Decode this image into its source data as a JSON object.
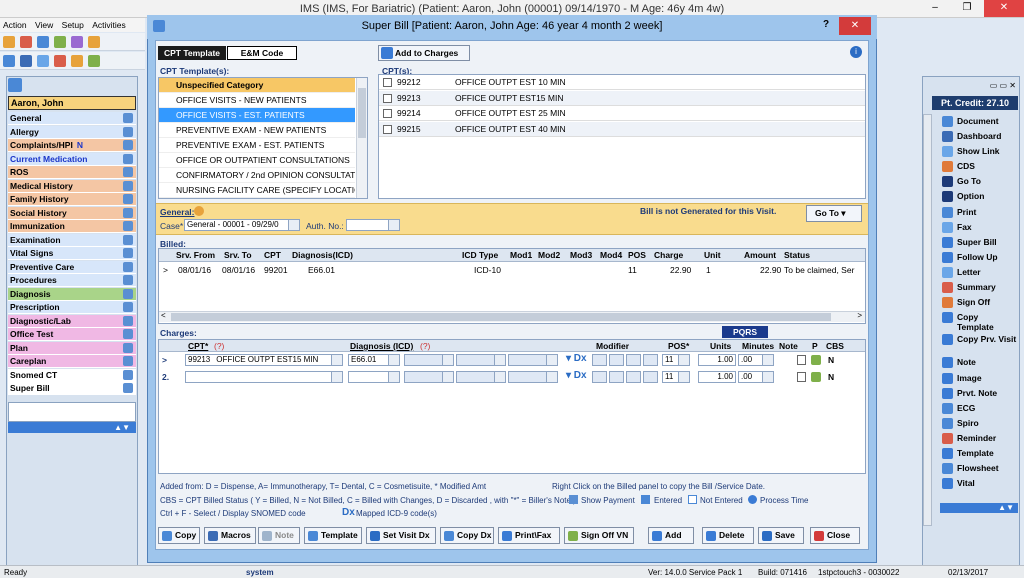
{
  "app": {
    "title": "IMS (IMS, For Bariatric)    (Patient: Aaron, John  (00001) 09/14/1970 - M Age: 46y 4m 4w)"
  },
  "menu": [
    "Action",
    "View",
    "Setup",
    "Activities"
  ],
  "left": {
    "patient": "Aaron, John",
    "items": [
      {
        "label": "General",
        "color": "#d7e6fa"
      },
      {
        "label": "Allergy",
        "color": "#d7e6fa"
      },
      {
        "label": "Complaints/HPI",
        "color": "#f4c6a4",
        "extra": "N"
      },
      {
        "label": "Current Medication",
        "color": "#d7e6fa",
        "blue": true
      },
      {
        "label": "ROS",
        "color": "#f4c6a4"
      },
      {
        "label": "Medical History",
        "color": "#f4c6a4"
      },
      {
        "label": "Family History",
        "color": "#f4c6a4"
      },
      {
        "label": "Social History",
        "color": "#f4c6a4"
      },
      {
        "label": "Immunization",
        "color": "#f4c6a4"
      },
      {
        "label": "Examination",
        "color": "#d7e6fa"
      },
      {
        "label": "Vital Signs",
        "color": "#d7e6fa"
      },
      {
        "label": "Preventive Care",
        "color": "#d7e6fa"
      },
      {
        "label": "Procedures",
        "color": "#d7e6fa"
      },
      {
        "label": "Diagnosis",
        "color": "#a9d489"
      },
      {
        "label": "Prescription",
        "color": "#d7e6fa"
      },
      {
        "label": "Diagnostic/Lab",
        "color": "#f0b8e4"
      },
      {
        "label": "Office Test",
        "color": "#f0b8e4"
      },
      {
        "label": "Plan",
        "color": "#f0b8e4"
      },
      {
        "label": "Careplan",
        "color": "#f0b8e4"
      },
      {
        "label": "Snomed CT",
        "color": "#ffffff"
      },
      {
        "label": "Super Bill",
        "color": "#ffffff"
      }
    ]
  },
  "right": {
    "credit": "Pt. Credit: 27.10",
    "buttons": [
      "Document",
      "Dashboard",
      "Show Link",
      "CDS",
      "Go To",
      "Option",
      "Print",
      "Fax",
      "Super Bill",
      "Follow Up",
      "Letter",
      "Summary",
      "Sign Off",
      "Copy Template",
      "Copy Prv. Visit",
      "Note",
      "Image",
      "Prvt. Note",
      "ECG",
      "Spiro",
      "Reminder",
      "Template",
      "Flowsheet",
      "Vital"
    ]
  },
  "dialog": {
    "title": "Super Bill  [Patient: Aaron, John   Age: 46 year 4 month 2 week]",
    "help": "?",
    "tab_cpt": "CPT Template",
    "tab_em": "E&M Code",
    "add_to_charges": "Add to Charges",
    "cpt_templates_label": "CPT Template(s):",
    "cpts_label": "CPT(s):",
    "templates": [
      "Unspecified Category",
      "OFFICE VISITS - NEW PATIENTS",
      "OFFICE VISITS - EST. PATIENTS",
      "PREVENTIVE EXAM - NEW PATIENTS",
      "PREVENTIVE EXAM - EST. PATIENTS",
      "OFFICE OR OUTPATIENT CONSULTATIONS",
      "CONFIRMATORY / 2nd OPINION CONSULTATIC",
      "NURSING FACILITY CARE (SPECIFY LOCATION"
    ],
    "cpts": [
      {
        "code": "99212",
        "desc": "OFFICE OUTPT EST 10 MIN"
      },
      {
        "code": "99213",
        "desc": "OFFICE OUTPT EST15 MIN"
      },
      {
        "code": "99214",
        "desc": "OFFICE OUTPT EST 25 MIN"
      },
      {
        "code": "99215",
        "desc": "OFFICE OUTPT EST 40 MIN"
      }
    ],
    "general_label": "General:",
    "case_label": "Case*",
    "case_value": "General - 00001 - 09/29/0",
    "auth_label": "Auth. No.:",
    "bill_status": "Bill is not Generated for this Visit.",
    "goto": "Go To",
    "billed_label": "Billed:",
    "billed_headers": [
      "Srv. From",
      "Srv. To",
      "CPT",
      "Diagnosis(ICD)",
      "ICD Type",
      "Mod1",
      "Mod2",
      "Mod3",
      "Mod4",
      "POS",
      "Charge",
      "Unit",
      "Amount",
      "Status"
    ],
    "billed_row": {
      "marker": ">",
      "from": "08/01/16",
      "to": "08/01/16",
      "cpt": "99201",
      "dx": "E66.01",
      "icdtype": "ICD-10",
      "pos": "11",
      "charge": "22.90",
      "unit": "1",
      "amount": "22.90",
      "status": "To be claimed, Ser"
    },
    "charges_label": "Charges:",
    "pqrs": "PQRS",
    "charge_headers": {
      "cpt": "CPT*",
      "cpt_q": "(?)",
      "dx": "Diagnosis (ICD)",
      "dx_q": "(?)",
      "mod": "Modifier",
      "pos": "POS*",
      "units": "Units",
      "minutes": "Minutes",
      "note": "Note",
      "p": "P",
      "cbs": "CBS"
    },
    "charge_rows": [
      {
        "marker": ">",
        "cpt": "99213",
        "desc": "OFFICE OUTPT EST15 MIN",
        "dx": "E66.01",
        "pos": "11",
        "units": "1.00",
        "minutes": ".00",
        "cbs": "N"
      },
      {
        "marker": "2.",
        "cpt": "",
        "desc": "",
        "dx": "",
        "pos": "11",
        "units": "1.00",
        "minutes": ".00",
        "cbs": "N"
      }
    ],
    "notes": [
      "Added from: D = Dispense, A= Immunotherapy, T= Dental,  C = Cosmetisuite,  * Modified Amt",
      "Right Click on the Billed panel to copy the Bill /Service Date.",
      "CBS = CPT Billed Status ( Y = Billed, N = Not Billed, C = Billed with Changes, D = Discarded , with \"*\" = Biller's Note )",
      "Show Payment",
      "Entered",
      "Not Entered",
      "Process Time",
      "Ctrl + F - Select / Display SNOMED code",
      "Mapped ICD-9 code(s)"
    ],
    "buttons": [
      "Copy",
      "Macros",
      "Note",
      "Template",
      "Set Visit Dx",
      "Copy Dx",
      "Print\\Fax",
      "Sign Off VN",
      "Add",
      "Delete",
      "Save",
      "Close"
    ]
  },
  "status": {
    "left": "Ready",
    "user": "system",
    "version": "Ver: 14.0.0 Service Pack 1",
    "build": "Build: 071416",
    "machine": "1stpctouch3 - 0030022",
    "date": "02/13/2017"
  },
  "colors": {
    "accent": "#3a7bd5",
    "orange": "#f7b733",
    "selected": "#3399ff"
  }
}
